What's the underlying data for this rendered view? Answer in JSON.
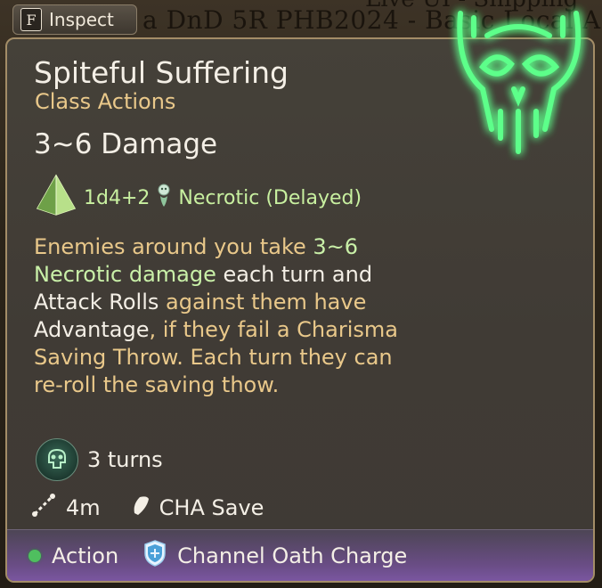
{
  "background": {
    "text_main": "a DnD 5R PHB2024 - Basic Local A",
    "text_top": "Live UI - Shipping"
  },
  "inspect": {
    "key": "F",
    "label": "Inspect"
  },
  "tooltip": {
    "title": "Spiteful Suffering",
    "subtitle": "Class Actions",
    "damage": "3~6 Damage",
    "dice": "1d4+2",
    "damage_type": "Necrotic (Delayed)",
    "description": {
      "p1": "Enemies around you take ",
      "p2": "3~6 Necrotic damage",
      "p3": " each turn and ",
      "p4": "Attack Rolls",
      "p5": " against them have ",
      "p6": "Advantage",
      "p7": ", if they fail a Charisma Saving Throw. Each turn they can re-roll the saving thow."
    },
    "duration": "3 turns",
    "range": "4m",
    "save": "CHA Save"
  },
  "footer": {
    "action": "Action",
    "resource": "Channel Oath Charge"
  },
  "colors": {
    "accent_gold": "#e9c88a",
    "necrotic_green": "#c9f0a8",
    "action_dot": "#4fbf5f",
    "footer_purple": "#7a56a0"
  },
  "icons": {
    "skull": "glowing-skull-icon",
    "dice": "d4-dice-icon",
    "necrotic": "necrotic-icon",
    "turns": "skull-status-icon",
    "range": "range-line-icon",
    "save": "save-shield-icon",
    "resource": "channel-oath-shield-icon"
  }
}
